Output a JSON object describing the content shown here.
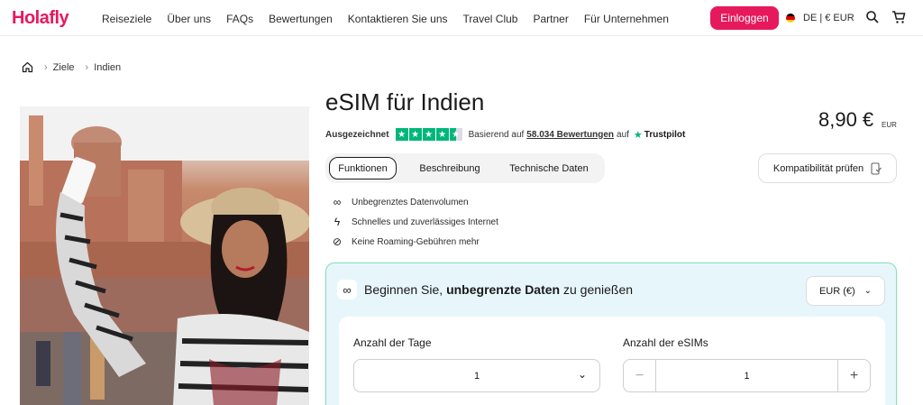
{
  "header": {
    "logo": "Holafly",
    "nav": [
      "Reiseziele",
      "Über uns",
      "FAQs",
      "Bewertungen",
      "Kontaktieren Sie uns",
      "Travel Club",
      "Partner",
      "Für Unternehmen"
    ],
    "login_label": "Einloggen",
    "lang_label": "DE | € EUR"
  },
  "breadcrumb": {
    "items": [
      "Ziele",
      "Indien"
    ]
  },
  "product": {
    "title": "eSIM für Indien",
    "rating_label": "Ausgezeichnet",
    "rating_prefix": "Basierend auf",
    "rating_count": "58.034 Bewertungen",
    "rating_suffix": "auf",
    "trustpilot": "Trustpilot",
    "price": "8,90 €",
    "currency_code": "EUR"
  },
  "tabs": [
    "Funktionen",
    "Beschreibung",
    "Technische Daten"
  ],
  "compat_label": "Kompatibilität prüfen",
  "features": [
    "Unbegrenztes Datenvolumen",
    "Schnelles und zuverlässiges Internet",
    "Keine Roaming-Gebühren mehr"
  ],
  "plan": {
    "heading_pre": "Beginnen Sie,",
    "heading_bold": "unbegrenzte Daten",
    "heading_post": "zu genießen",
    "currency_select": "EUR (€)",
    "days_label": "Anzahl der Tage",
    "days_value": "1",
    "esims_label": "Anzahl der eSIMs",
    "esims_value": "1"
  },
  "colors": {
    "brand": "#e6195d",
    "trustpilot": "#00b67a",
    "panel_bg": "#e7f6fb",
    "panel_border": "#7fe0b4"
  }
}
